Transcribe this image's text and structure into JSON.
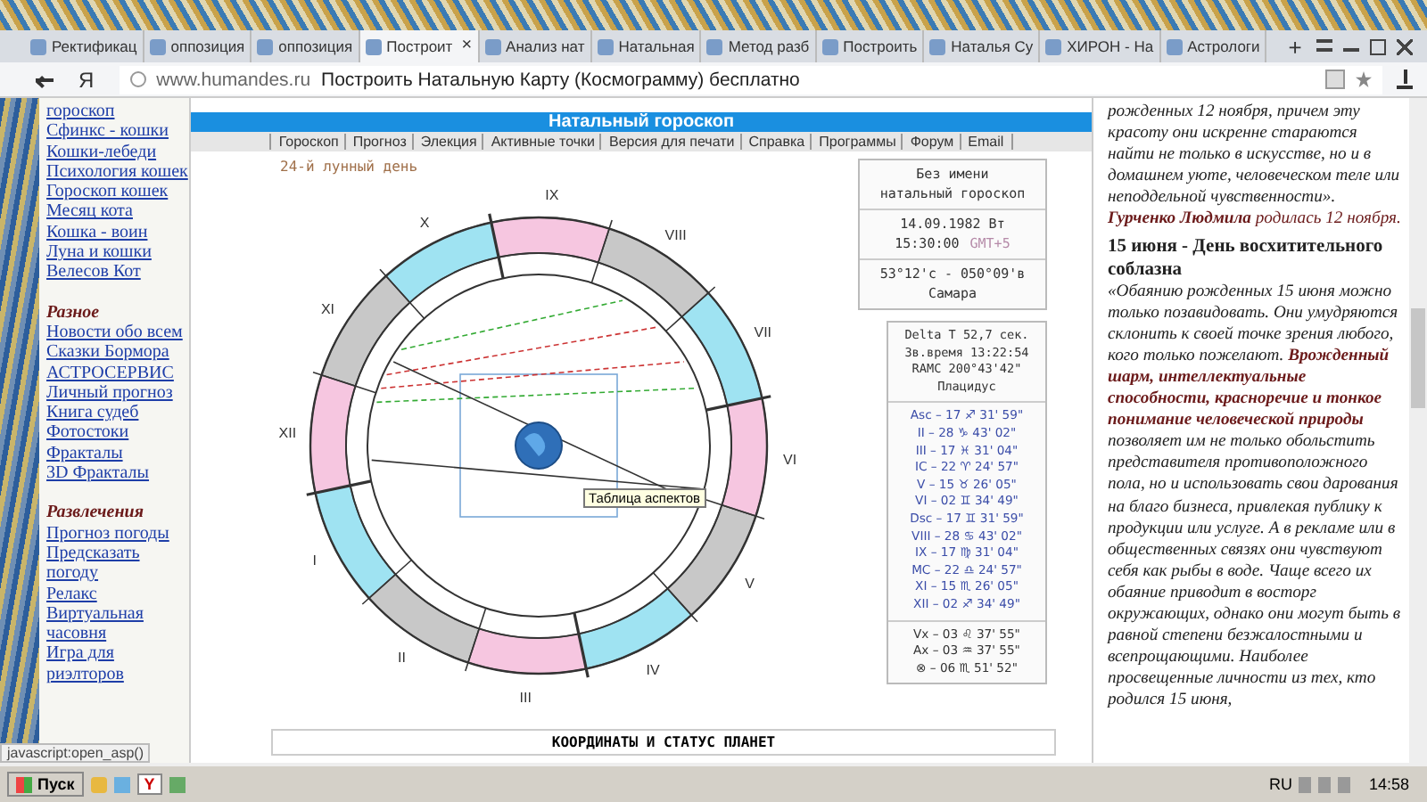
{
  "browser": {
    "tabs": [
      {
        "label": "Ректификац",
        "selected": false
      },
      {
        "label": "оппозиция",
        "selected": false
      },
      {
        "label": "оппозиция",
        "selected": false
      },
      {
        "label": "Построит",
        "selected": true
      },
      {
        "label": "Анализ нат",
        "selected": false
      },
      {
        "label": "Натальная",
        "selected": false
      },
      {
        "label": "Метод разб",
        "selected": false
      },
      {
        "label": "Построить",
        "selected": false
      },
      {
        "label": "Наталья Су",
        "selected": false
      },
      {
        "label": "ХИРОН - На",
        "selected": false
      },
      {
        "label": "Астрологи",
        "selected": false
      }
    ],
    "new_tab": "+",
    "close_tab": "×",
    "logo": "Я",
    "domain": "www.humandes.ru",
    "page_title": "Построить Натальную Карту (Космограмму) бесплатно",
    "status_text": "javascript:open_asp()"
  },
  "sidebar": {
    "items": [
      {
        "kind": "link",
        "text": "гороскоп"
      },
      {
        "kind": "link",
        "text": "Сфинкс - кошки"
      },
      {
        "kind": "link",
        "text": "Кошки-лебеди"
      },
      {
        "kind": "link",
        "text": "Психология кошек"
      },
      {
        "kind": "link",
        "text": "Гороскоп кошек"
      },
      {
        "kind": "link",
        "text": "Месяц кота"
      },
      {
        "kind": "link",
        "text": "Кошка - воин"
      },
      {
        "kind": "link",
        "text": "Луна и кошки"
      },
      {
        "kind": "link",
        "text": "Велесов Кот"
      },
      {
        "kind": "heading",
        "text": "Разное"
      },
      {
        "kind": "link",
        "text": "Новости обо всем"
      },
      {
        "kind": "link",
        "text": "Сказки Бормора"
      },
      {
        "kind": "link",
        "text": "АСТРОСЕРВИС"
      },
      {
        "kind": "link",
        "text": "Личный прогноз"
      },
      {
        "kind": "link",
        "text": "Книга судеб"
      },
      {
        "kind": "link",
        "text": "Фотостоки"
      },
      {
        "kind": "link",
        "text": "Фракталы"
      },
      {
        "kind": "link",
        "text": "3D Фракталы"
      },
      {
        "kind": "heading",
        "text": "Развлечения"
      },
      {
        "kind": "link",
        "text": "Прогноз погоды"
      },
      {
        "kind": "link",
        "text": "Предсказать погоду"
      },
      {
        "kind": "link",
        "text": "Релакс"
      },
      {
        "kind": "link",
        "text": "Виртуальная часовня"
      },
      {
        "kind": "link",
        "text": "Игра для риэлторов"
      }
    ]
  },
  "main": {
    "title": "Натальный гороскоп",
    "nav": [
      "Гороскоп",
      "Прогноз",
      "Элекция",
      "Активные точки",
      "Версия для печати",
      "Справка",
      "Программы",
      "Форум",
      "Email"
    ],
    "lunar_day": "24-й лунный день",
    "chart": {
      "houses": [
        "I",
        "II",
        "III",
        "IV",
        "V",
        "VI",
        "VII",
        "VIII",
        "IX",
        "X",
        "XI",
        "XII"
      ],
      "tooltip": "Таблица аспектов"
    },
    "info": {
      "name": "Без имени",
      "type": "натальный гороскоп",
      "date": "14.09.1982 Вт",
      "time": "15:30:00",
      "zone": "GMT+5",
      "coords": "53°12'с - 050°09'в",
      "place": "Самара"
    },
    "params": [
      "Delta T  52,7 сек.",
      "Зв.время 13:22:54",
      "RAMC 200°43'42\"",
      "Плацидус"
    ],
    "cusps": [
      "Asc – 17 ♐ 31' 59\"",
      "II – 28 ♑ 43' 02\"",
      "III – 17 ♓ 31' 04\"",
      "IC – 22 ♈ 24' 57\"",
      "V – 15 ♉ 26' 05\"",
      "VI – 02 ♊ 34' 49\"",
      "Dsc – 17 ♊ 31' 59\"",
      "VIII – 28 ♋ 43' 02\"",
      "IX – 17 ♍ 31' 04\"",
      "MC – 22 ♎ 24' 57\"",
      "XI – 15 ♏ 26' 05\"",
      "XII – 02 ♐ 34' 49\""
    ],
    "points": [
      "Vx – 03 ♌ 37' 55\"",
      "Ax – 03 ♒ 37' 55\"",
      "⊗ – 06 ♏ 51' 52\""
    ],
    "section": "КООРДИНАТЫ И СТАТУС ПЛАНЕТ"
  },
  "article": [
    {
      "kind": "quote",
      "text": "рожденных 12 ноября, причем эту красоту они искренне стараются найти не только в искусстве, но и в домашнем уюте, человеческом теле или неподдельной чувственности»."
    },
    {
      "kind": "note",
      "text": "**Гурченко Людмила** родилась 12 ноября."
    },
    {
      "kind": "heading",
      "text": "15 июня - День восхитительного соблазна"
    },
    {
      "kind": "quote",
      "text": "«Обаянию рожденных 15 июня можно только позавидовать. Они умудряются склонить к своей точке зрения любого, кого только пожелают. **Врожденный шарм, интеллектуальные способности, красноречие и тонкое понимание человеческой природы** позволяет им не только обольстить представителя противоположного пола, но и использовать свои дарования на благо бизнеса, привлекая публику к продукции или услуге. А в рекламе или в общественных связях они чувствуют себя как рыбы в воде. Чаще всего их обаяние приводит в восторг окружающих, однако они могут быть в равной степени безжалостными и всепрощающими. Наиболее просвещенные личности из тех, кто родился 15 июня,"
    }
  ],
  "taskbar": {
    "start": "Пуск",
    "browser_app": "Y",
    "lang": "RU",
    "clock": "14:58"
  }
}
